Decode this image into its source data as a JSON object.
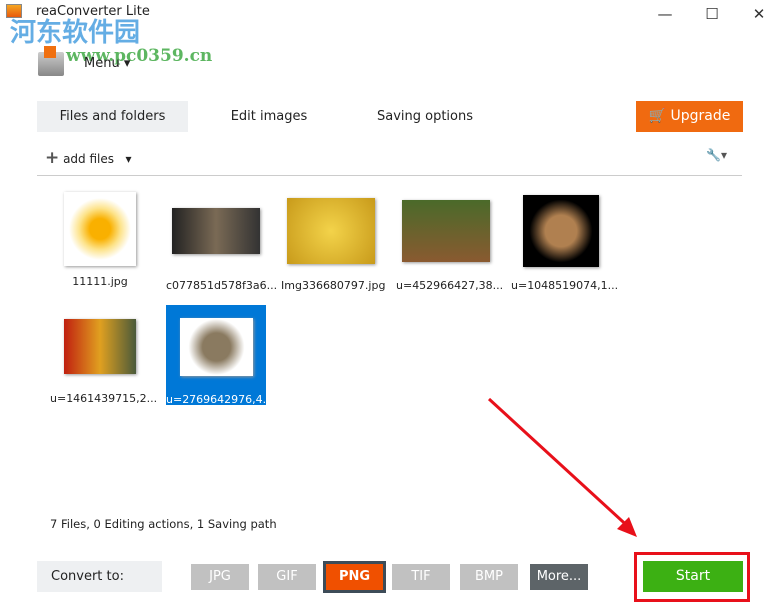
{
  "window": {
    "title": "reaConverter Lite",
    "minimize": "—",
    "maximize": "☐",
    "close": "✕"
  },
  "watermark": {
    "text": "河东软件园",
    "url": "www.pc0359.cn"
  },
  "menu": {
    "label": "Menu",
    "caret": "▾"
  },
  "tabs": [
    {
      "label": "Files and folders",
      "active": true
    },
    {
      "label": "Edit images"
    },
    {
      "label": "Saving options"
    }
  ],
  "upgrade": {
    "label": "Upgrade",
    "icon": "cart-icon"
  },
  "toolbar": {
    "add_files": "add files",
    "plus": "+",
    "caret": "▾",
    "tools_icon": "wrench-icon",
    "wrench": "🔧"
  },
  "files": [
    {
      "name": "11111.jpg",
      "selected": false
    },
    {
      "name": "c077851d578f3a6...",
      "selected": false
    },
    {
      "name": "Img336680797.jpg",
      "selected": false
    },
    {
      "name": "u=452966427,38...",
      "selected": false
    },
    {
      "name": "u=1048519074,1...",
      "selected": false
    },
    {
      "name": "u=1461439715,2...",
      "selected": false
    },
    {
      "name": "u=2769642976,4...",
      "selected": true
    }
  ],
  "status": "7 Files,  0 Editing actions,  1 Saving path",
  "convert": {
    "label": "Convert to:",
    "formats": [
      {
        "label": "JPG"
      },
      {
        "label": "GIF"
      },
      {
        "label": "PNG",
        "selected": true
      },
      {
        "label": "TIF"
      },
      {
        "label": "BMP"
      },
      {
        "label": "More..."
      }
    ]
  },
  "start": {
    "label": "Start"
  },
  "colors": {
    "accent": "#f06a10",
    "start": "#3cb013",
    "selection": "#0078d7",
    "annotation": "#e8101a"
  }
}
